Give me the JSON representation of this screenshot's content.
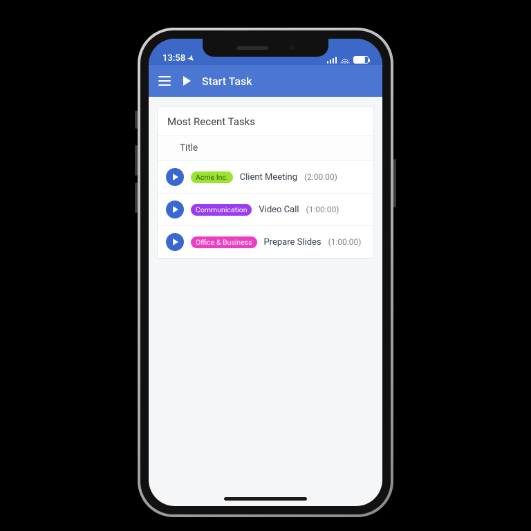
{
  "status": {
    "time": "13:58",
    "location_icon": "location-arrow"
  },
  "appbar": {
    "title": "Start Task"
  },
  "card": {
    "heading": "Most Recent Tasks",
    "column": "Title"
  },
  "tasks": [
    {
      "tag": "Acme Inc.",
      "tag_bg": "#9be233",
      "tag_fg": "#2e5b00",
      "title": "Client Meeting",
      "duration": "(2:00:00)"
    },
    {
      "tag": "Communication",
      "tag_bg": "#9a3df0",
      "tag_fg": "#ffffff",
      "title": "Video Call",
      "duration": "(1:00:00)"
    },
    {
      "tag": "Office & Business",
      "tag_bg": "#ee3fc0",
      "tag_fg": "#ffffff",
      "title": "Prepare Slides",
      "duration": "(1:00:00)"
    }
  ],
  "colors": {
    "brand": "#4b77d3",
    "play": "#3a68d2"
  }
}
